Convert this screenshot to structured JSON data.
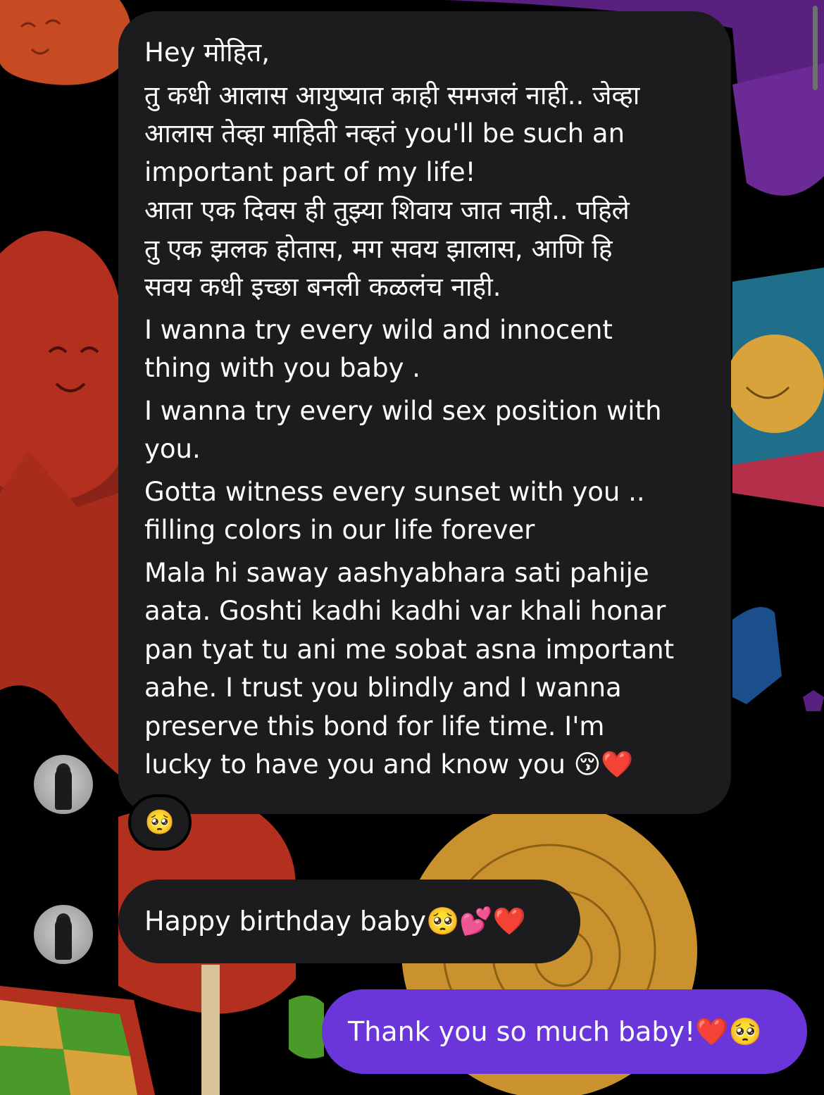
{
  "colors": {
    "incoming_bubble": "#1c1c1f",
    "outgoing_bubble": "#6a36d9",
    "text": "#ffffff"
  },
  "thread": {
    "messages": [
      {
        "id": "m1",
        "direction": "incoming",
        "paragraphs": [
          "Hey मोहित,",
          "तु कधी आलास आयुष्यात काही समजलं नाही.. जेव्हा\nआलास तेव्हा माहिती नव्हतं you'll be such an\nimportant part of my life!\nआता एक दिवस ही तुझ्या शिवाय जात नाही.. पहिले\nतु एक झलक होतास, मग सवय झालास, आणि हि\nसवय कधी इच्छा बनली कळलंच नाही.",
          "I wanna try every wild and innocent\nthing with you baby .",
          "I wanna try every wild sex position with\nyou.",
          "Gotta witness every sunset with you ..\nfilling colors in our life forever",
          "Mala hi saway aashyabhara sati pahije\naata. Goshti kadhi kadhi var khali honar\npan tyat tu ani me sobat asna important\naahe. I trust you blindly and I wanna\npreserve this bond for life time. I'm\nlucky to have you and know you 😚❤️"
        ],
        "reaction": "🥺"
      },
      {
        "id": "m2",
        "direction": "incoming",
        "text": "Happy birthday baby🥺💕❤️"
      },
      {
        "id": "m3",
        "direction": "outgoing",
        "text": "Thank you so much baby!❤️🥺"
      }
    ]
  }
}
